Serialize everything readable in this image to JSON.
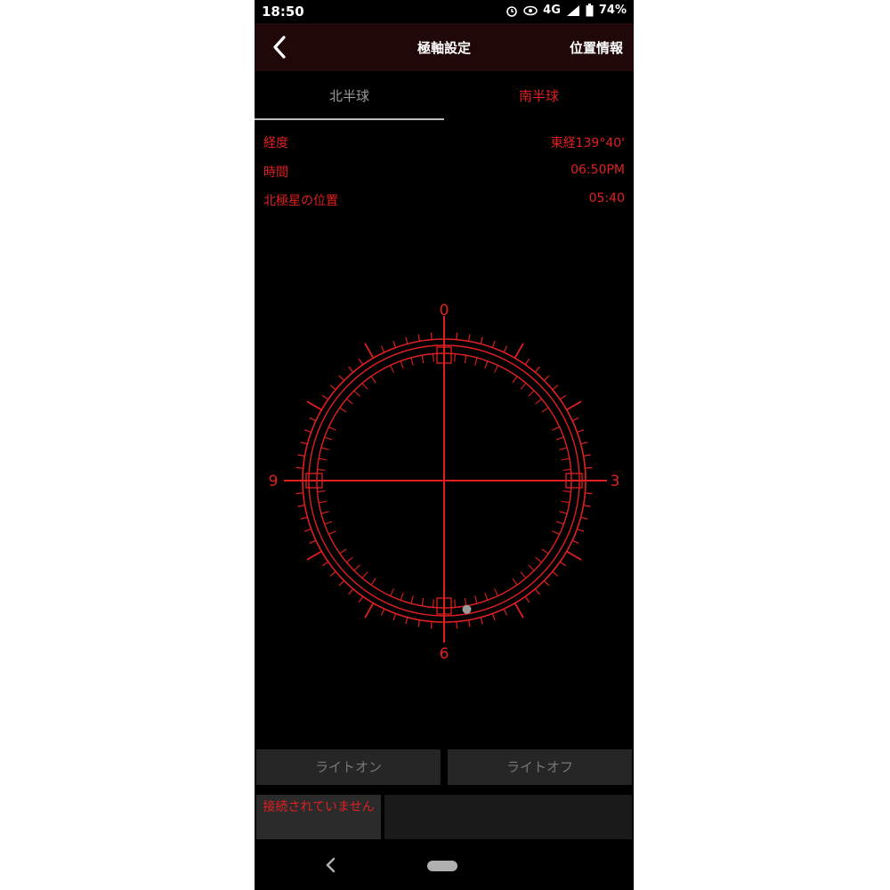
{
  "status_bar": {
    "time": "18:50",
    "network": "4G",
    "battery": "74%",
    "icons": [
      "alarm-icon",
      "eye-icon",
      "signal-icon",
      "battery-icon"
    ]
  },
  "header": {
    "title": "極軸設定",
    "location_button": "位置情報",
    "back_icon": "back-arrow-icon"
  },
  "tabs": [
    {
      "label": "北半球"
    },
    {
      "label": "南半球"
    }
  ],
  "info": [
    {
      "label": "経度",
      "value": "東経139°40'"
    },
    {
      "label": "時間",
      "value": "06:50PM"
    },
    {
      "label": "北極星の位置",
      "value": "05:40"
    }
  ],
  "dial": {
    "labels": {
      "top": "0",
      "right": "3",
      "bottom": "6",
      "left": "9"
    },
    "polaris_hour": 5.667,
    "line_color": "#e02020"
  },
  "buttons": {
    "light_on": "ライトオン",
    "light_off": "ライトオフ"
  },
  "connection_status": "接続されていません",
  "colors": {
    "accent": "#e02020",
    "header_bg": "#200808",
    "background": "#000000"
  }
}
